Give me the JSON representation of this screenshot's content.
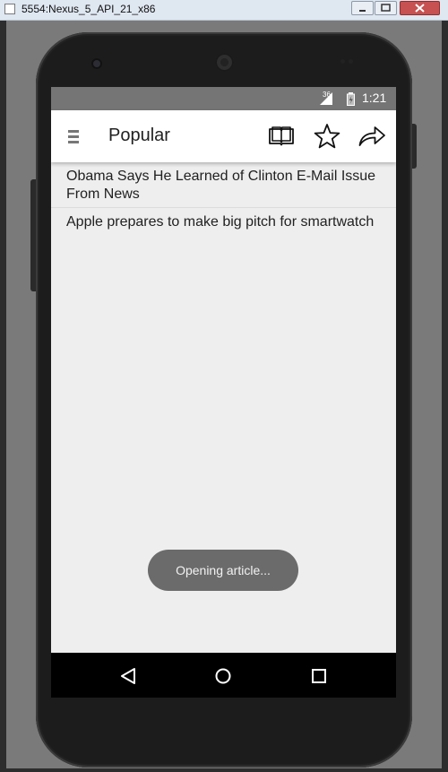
{
  "window": {
    "title": "5554:Nexus_5_API_21_x86"
  },
  "status_bar": {
    "network": "36",
    "time": "1:21"
  },
  "app_bar": {
    "title": "Popular",
    "menu_icon": "hamburger-menu-icon",
    "actions": [
      {
        "name": "book-icon"
      },
      {
        "name": "star-icon"
      },
      {
        "name": "share-icon"
      }
    ]
  },
  "articles": [
    {
      "title": "Obama Says He Learned of Clinton E-Mail Issue From News"
    },
    {
      "title": "Apple prepares to make big pitch for smartwatch"
    }
  ],
  "toast": {
    "message": "Opening article..."
  },
  "nav_bar": {
    "buttons": [
      "back-icon",
      "home-icon",
      "recents-icon"
    ]
  },
  "colors": {
    "status_bar": "#757575",
    "app_bar": "#ffffff",
    "screen_bg": "#eeeeee",
    "toast_bg": "#6b6b6b",
    "nav_bar": "#000000"
  }
}
